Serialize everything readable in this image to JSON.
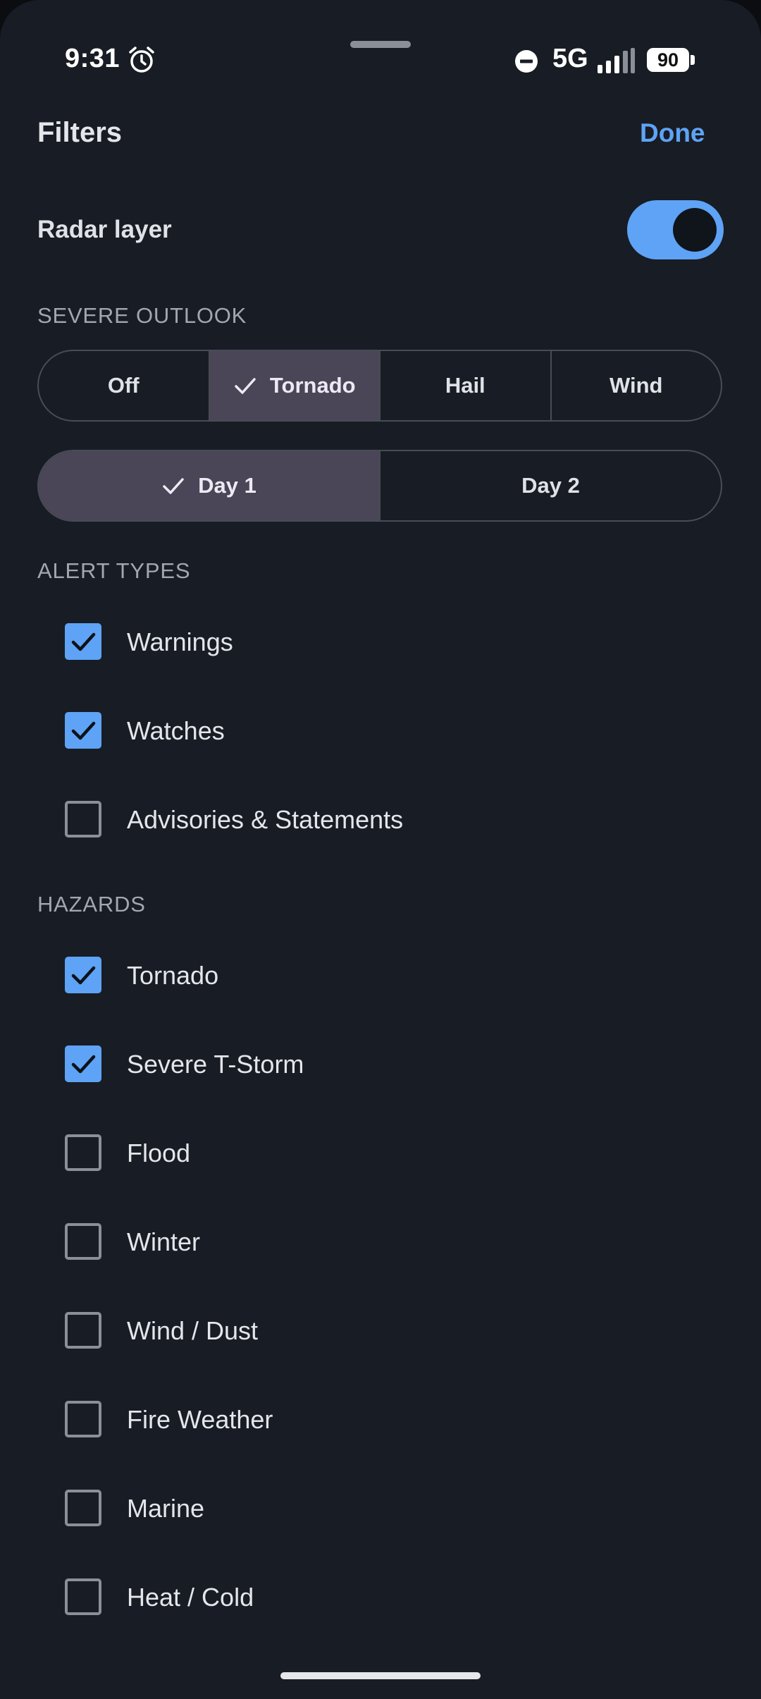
{
  "status_bar": {
    "time": "9:31",
    "network": "5G",
    "battery": "90",
    "icons": [
      "alarm-icon",
      "dnd-icon",
      "signal-icon",
      "battery-icon"
    ]
  },
  "header": {
    "title": "Filters",
    "done_label": "Done"
  },
  "radar": {
    "label": "Radar layer",
    "enabled": true
  },
  "severe_outlook": {
    "header": "SEVERE OUTLOOK",
    "options": [
      {
        "label": "Off",
        "selected": false
      },
      {
        "label": "Tornado",
        "selected": true
      },
      {
        "label": "Hail",
        "selected": false
      },
      {
        "label": "Wind",
        "selected": false
      }
    ],
    "days": [
      {
        "label": "Day 1",
        "selected": true
      },
      {
        "label": "Day 2",
        "selected": false
      }
    ]
  },
  "alert_types": {
    "header": "ALERT TYPES",
    "items": [
      {
        "label": "Warnings",
        "checked": true
      },
      {
        "label": "Watches",
        "checked": true
      },
      {
        "label": "Advisories & Statements",
        "checked": false
      }
    ]
  },
  "hazards": {
    "header": "HAZARDS",
    "items": [
      {
        "label": "Tornado",
        "checked": true
      },
      {
        "label": "Severe T-Storm",
        "checked": true
      },
      {
        "label": "Flood",
        "checked": false
      },
      {
        "label": "Winter",
        "checked": false
      },
      {
        "label": "Wind / Dust",
        "checked": false
      },
      {
        "label": "Fire Weather",
        "checked": false
      },
      {
        "label": "Marine",
        "checked": false
      },
      {
        "label": "Heat / Cold",
        "checked": false
      }
    ]
  },
  "colors": {
    "accent": "#5ea3f5",
    "background": "#181c24",
    "selected_segment": "#4b4558"
  }
}
